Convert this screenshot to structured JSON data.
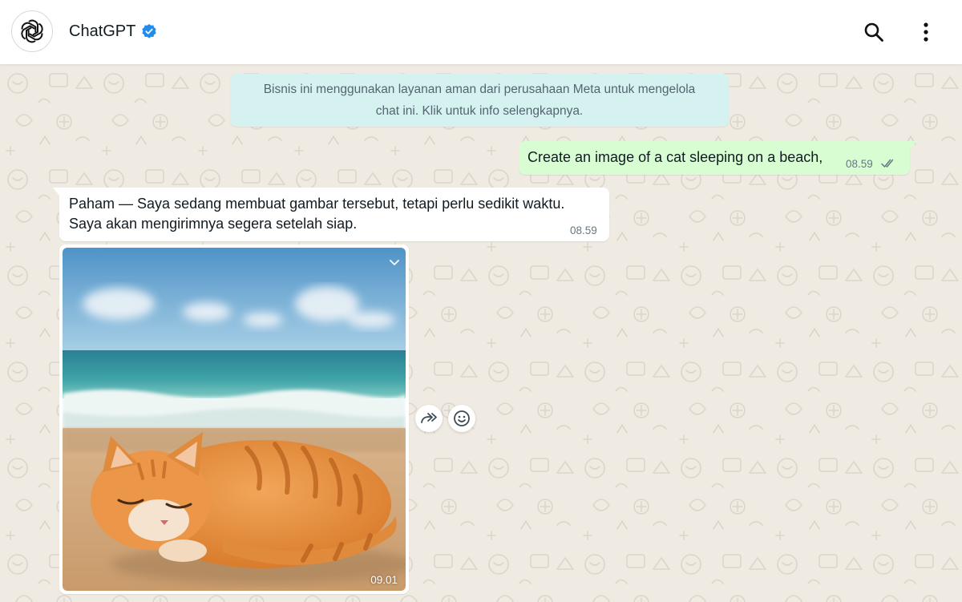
{
  "header": {
    "contact_name": "ChatGPT",
    "avatar_icon": "openai-logo-icon",
    "verified_icon": "verified-badge-icon",
    "search_icon": "search-icon",
    "menu_icon": "more-vertical-icon"
  },
  "notice": {
    "line1": "Bisnis ini menggunakan layanan aman dari perusahaan Meta untuk mengelola",
    "line2": "chat ini. Klik untuk info selengkapnya."
  },
  "messages": {
    "outgoing": {
      "text": "Create an image of a cat sleeping on a beach,",
      "time": "08.59",
      "status_icon": "double-check-icon"
    },
    "incoming": {
      "line1": "Paham — Saya sedang membuat gambar tersebut, tetapi perlu sedikit waktu.",
      "line2": "Saya akan mengirimnya segera setelah siap.",
      "time": "08.59"
    },
    "image": {
      "time": "09.01",
      "depicts": "cat-sleeping-on-beach-image"
    }
  },
  "actions": {
    "forward_icon": "forward-icon",
    "react_icon": "emoji-icon"
  },
  "colors": {
    "chat_background": "#efeae2",
    "outgoing_bubble": "#d9fdd3",
    "notice_bubble": "#d5f2f1",
    "verified_blue": "#1f8cf0"
  }
}
